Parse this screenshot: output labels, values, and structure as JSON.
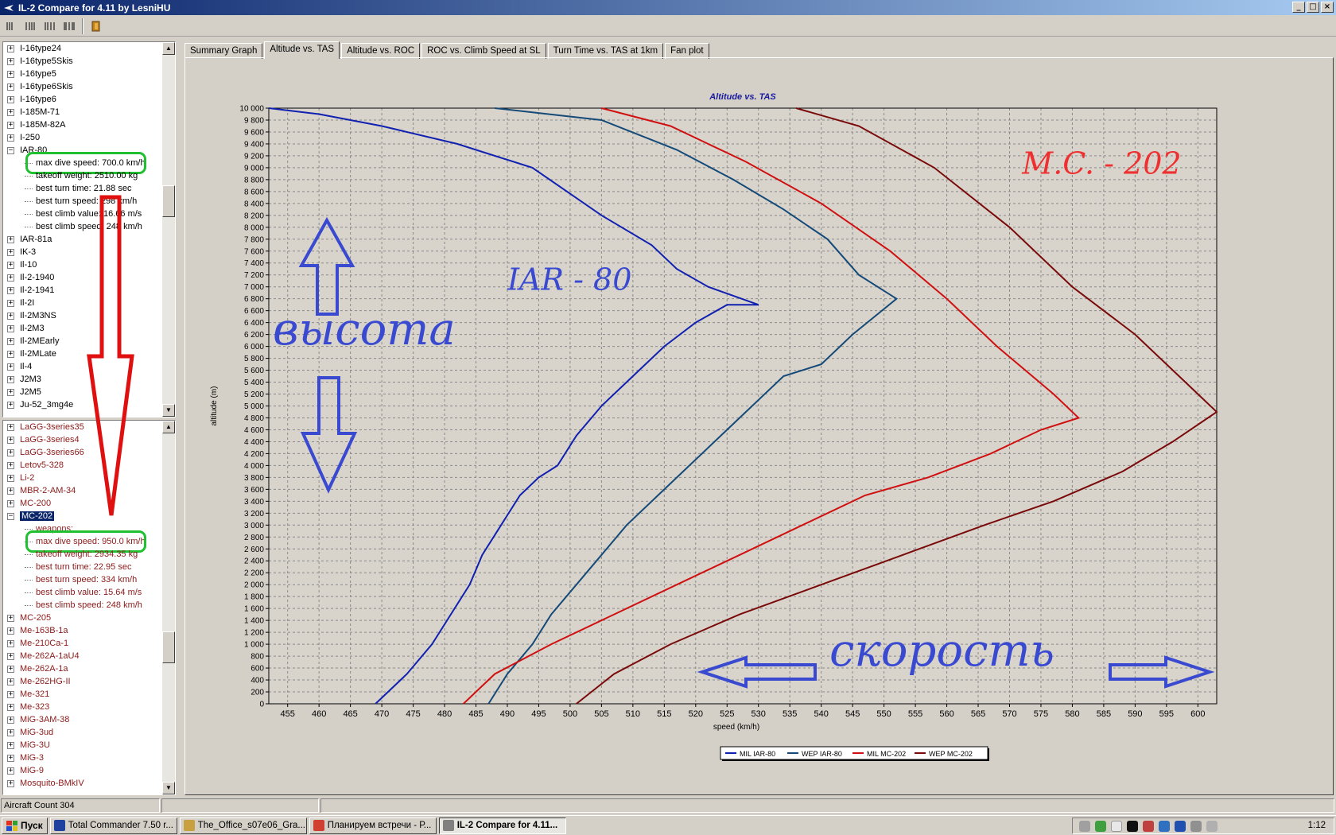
{
  "window": {
    "title": "IL-2 Compare for 4.11 by LesniHU"
  },
  "toolbar": {
    "icons": [
      "compare-1-icon",
      "compare-2-icon",
      "compare-3-icon",
      "compare-4-icon",
      "exit-icon"
    ]
  },
  "tree1": {
    "items": [
      {
        "label": "I-16type24",
        "type": "node"
      },
      {
        "label": "I-16type5Skis",
        "type": "node"
      },
      {
        "label": "I-16type5",
        "type": "node"
      },
      {
        "label": "I-16type6Skis",
        "type": "node"
      },
      {
        "label": "I-16type6",
        "type": "node"
      },
      {
        "label": "I-185M-71",
        "type": "node"
      },
      {
        "label": "I-185M-82A",
        "type": "node"
      },
      {
        "label": "I-250",
        "type": "node"
      },
      {
        "label": "IAR-80",
        "type": "expanded"
      },
      {
        "label": "max dive speed: 700.0 km/h",
        "type": "child",
        "highlight": true
      },
      {
        "label": "takeoff weight: 2510.00 kg",
        "type": "child"
      },
      {
        "label": "best turn time: 21.88 sec",
        "type": "child"
      },
      {
        "label": "best turn speed: 298 km/h",
        "type": "child"
      },
      {
        "label": "best climb value: 16.66 m/s",
        "type": "child"
      },
      {
        "label": "best climb speed: 248 km/h",
        "type": "child"
      },
      {
        "label": "IAR-81a",
        "type": "node"
      },
      {
        "label": "IK-3",
        "type": "node"
      },
      {
        "label": "Il-10",
        "type": "node"
      },
      {
        "label": "Il-2-1940",
        "type": "node"
      },
      {
        "label": "Il-2-1941",
        "type": "node"
      },
      {
        "label": "Il-2I",
        "type": "node"
      },
      {
        "label": "Il-2M3NS",
        "type": "node"
      },
      {
        "label": "Il-2M3",
        "type": "node"
      },
      {
        "label": "Il-2MEarly",
        "type": "node"
      },
      {
        "label": "Il-2MLate",
        "type": "node"
      },
      {
        "label": "Il-4",
        "type": "node"
      },
      {
        "label": "J2M3",
        "type": "node"
      },
      {
        "label": "J2M5",
        "type": "node"
      },
      {
        "label": "Ju-52_3mg4e",
        "type": "node"
      }
    ]
  },
  "tree2": {
    "items": [
      {
        "label": "LaGG-3series35",
        "type": "node"
      },
      {
        "label": "LaGG-3series4",
        "type": "node"
      },
      {
        "label": "LaGG-3series66",
        "type": "node"
      },
      {
        "label": "Letov5-328",
        "type": "node"
      },
      {
        "label": "Li-2",
        "type": "node"
      },
      {
        "label": "MBR-2-AM-34",
        "type": "node"
      },
      {
        "label": "MC-200",
        "type": "node"
      },
      {
        "label": "MC-202",
        "type": "expanded",
        "selected": true
      },
      {
        "label": "weapons:",
        "type": "child"
      },
      {
        "label": "max dive speed: 950.0 km/h",
        "type": "child",
        "highlight": true
      },
      {
        "label": "takeoff weight: 2934.35 kg",
        "type": "child"
      },
      {
        "label": "best turn time: 22.95 sec",
        "type": "child"
      },
      {
        "label": "best turn speed: 334 km/h",
        "type": "child"
      },
      {
        "label": "best climb value: 15.64 m/s",
        "type": "child"
      },
      {
        "label": "best climb speed: 248 km/h",
        "type": "child"
      },
      {
        "label": "MC-205",
        "type": "node"
      },
      {
        "label": "Me-163B-1a",
        "type": "node"
      },
      {
        "label": "Me-210Ca-1",
        "type": "node"
      },
      {
        "label": "Me-262A-1aU4",
        "type": "node"
      },
      {
        "label": "Me-262A-1a",
        "type": "node"
      },
      {
        "label": "Me-262HG-II",
        "type": "node"
      },
      {
        "label": "Me-321",
        "type": "node"
      },
      {
        "label": "Me-323",
        "type": "node"
      },
      {
        "label": "MiG-3AM-38",
        "type": "node"
      },
      {
        "label": "MiG-3ud",
        "type": "node"
      },
      {
        "label": "MiG-3U",
        "type": "node"
      },
      {
        "label": "MiG-3",
        "type": "node"
      },
      {
        "label": "MiG-9",
        "type": "node"
      },
      {
        "label": "Mosquito-BMkIV",
        "type": "node"
      }
    ]
  },
  "tabs": [
    {
      "label": "Summary Graph",
      "active": false
    },
    {
      "label": "Altitude vs. TAS",
      "active": true
    },
    {
      "label": "Altitude vs. ROC",
      "active": false
    },
    {
      "label": "ROC vs. Climb Speed at SL",
      "active": false
    },
    {
      "label": "Turn Time vs. TAS at 1km",
      "active": false
    },
    {
      "label": "Fan plot",
      "active": false
    }
  ],
  "chart_data": {
    "type": "line",
    "title": "Altitude vs. TAS",
    "xlabel": "speed (km/h)",
    "ylabel": "altitude (m)",
    "xlim": [
      452,
      603
    ],
    "ylim": [
      0,
      10000
    ],
    "grid": true,
    "legend_position": "bottom-center",
    "x_ticks": [
      455,
      460,
      465,
      470,
      475,
      480,
      485,
      490,
      495,
      500,
      505,
      510,
      515,
      520,
      525,
      530,
      535,
      540,
      545,
      550,
      555,
      560,
      565,
      570,
      575,
      580,
      585,
      590,
      595,
      600
    ],
    "y_ticks": [
      0,
      200,
      400,
      600,
      800,
      1000,
      1200,
      1400,
      1600,
      1800,
      2000,
      2200,
      2400,
      2600,
      2800,
      3000,
      3200,
      3400,
      3600,
      3800,
      4000,
      4200,
      4400,
      4600,
      4800,
      5000,
      5200,
      5400,
      5600,
      5800,
      6000,
      6200,
      6400,
      6600,
      6800,
      7000,
      7200,
      7400,
      7600,
      7800,
      8000,
      8200,
      8400,
      8600,
      8800,
      9000,
      9200,
      9400,
      9600,
      9800,
      10000
    ],
    "y_tick_labels": [
      "0",
      "200",
      "400",
      "600",
      "800",
      "1 000",
      "1 200",
      "1 400",
      "1 600",
      "1 800",
      "2 000",
      "2 200",
      "2 400",
      "2 600",
      "2 800",
      "3 000",
      "3 200",
      "3 400",
      "3 600",
      "3 800",
      "4 000",
      "4 200",
      "4 400",
      "4 600",
      "4 800",
      "5 000",
      "5 200",
      "5 400",
      "5 600",
      "5 800",
      "6 000",
      "6 200",
      "6 400",
      "6 600",
      "6 800",
      "7 000",
      "7 200",
      "7 400",
      "7 600",
      "7 800",
      "8 000",
      "8 200",
      "8 400",
      "8 600",
      "8 800",
      "9 000",
      "9 200",
      "9 400",
      "9 600",
      "9 800",
      "10 000"
    ],
    "series": [
      {
        "name": "MIL  IAR-80",
        "color": "#1020b0",
        "x": [
          469,
          474,
          478,
          481,
          484,
          486,
          489,
          492,
          495,
          498,
          501,
          505,
          510,
          515,
          520,
          525,
          530,
          522,
          517,
          513,
          505,
          494,
          482,
          470,
          460,
          452
        ],
        "y": [
          0,
          500,
          1000,
          1500,
          2000,
          2500,
          3000,
          3500,
          3800,
          4000,
          4500,
          5000,
          5500,
          6000,
          6400,
          6700,
          6700,
          7000,
          7300,
          7700,
          8200,
          9000,
          9400,
          9700,
          9900,
          10000
        ]
      },
      {
        "name": "WEP IAR-80",
        "color": "#154a78",
        "x": [
          487,
          490,
          494,
          497,
          501,
          505,
          509,
          514,
          519,
          524,
          529,
          534,
          540,
          545,
          552,
          546,
          541,
          534,
          526,
          517,
          505,
          488
        ],
        "y": [
          0,
          500,
          1000,
          1500,
          2000,
          2500,
          3000,
          3500,
          4000,
          4500,
          5000,
          5500,
          5700,
          6200,
          6800,
          7200,
          7800,
          8300,
          8800,
          9300,
          9800,
          10000
        ]
      },
      {
        "name": "MIL  MC-202",
        "color": "#d01010",
        "x": [
          483,
          488,
          497,
          507,
          517,
          527,
          537,
          547,
          557,
          567,
          575,
          581,
          577,
          568,
          560,
          551,
          540,
          528,
          516,
          505
        ],
        "y": [
          0,
          500,
          1000,
          1500,
          2000,
          2500,
          3000,
          3500,
          3800,
          4200,
          4600,
          4800,
          5200,
          6000,
          6800,
          7600,
          8400,
          9100,
          9700,
          10000
        ]
      },
      {
        "name": "WEP MC-202",
        "color": "#7a0a0a",
        "x": [
          501,
          507,
          516,
          527,
          540,
          553,
          566,
          577,
          588,
          596,
          603,
          598,
          590,
          580,
          570,
          558,
          546,
          536
        ],
        "y": [
          0,
          500,
          1000,
          1500,
          2000,
          2500,
          3000,
          3400,
          3900,
          4400,
          4900,
          5400,
          6200,
          7000,
          8000,
          9000,
          9700,
          10000
        ]
      }
    ],
    "annotations": [
      {
        "text": "IAR - 80",
        "x": 490,
        "y": 6950,
        "color": "#3a4ad0"
      },
      {
        "text": "M.C. - 202",
        "x": 572,
        "y": 8900,
        "color": "#ee3030"
      },
      {
        "text": "высота",
        "color": "#3a4ad0"
      },
      {
        "text": "скорость",
        "color": "#3a4ad0"
      }
    ]
  },
  "status": {
    "aircraft_count": "Aircraft Count 304"
  },
  "taskbar": {
    "start_label": "Пуск",
    "tasks": [
      {
        "label": "Total Commander 7.50 r...",
        "color": "#2040a0",
        "active": false
      },
      {
        "label": "The_Office_s07e06_Gra...",
        "color": "#c8a040",
        "active": false
      },
      {
        "label": "Планируем встречи - Р...",
        "color": "#d04030",
        "active": false
      },
      {
        "label": "IL-2 Compare for 4.11...",
        "color": "#808080",
        "active": true
      }
    ],
    "clock": "1:12"
  }
}
